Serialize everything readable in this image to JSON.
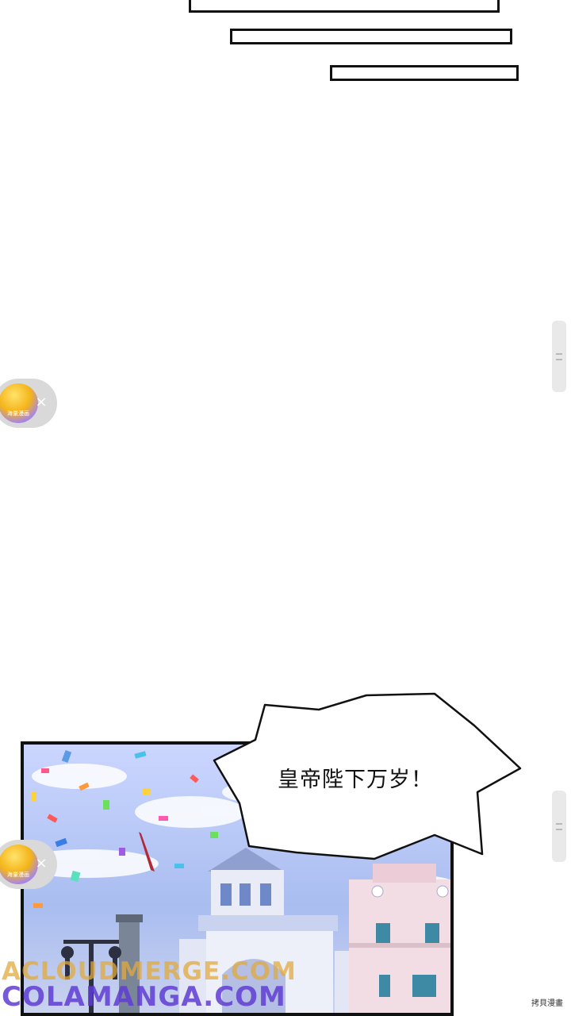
{
  "speech_bubble": {
    "text": "皇帝陛下万岁！"
  },
  "float_ads": [
    {
      "badge_text": "海量漫画",
      "close_symbol": "×"
    },
    {
      "badge_text": "海量漫画",
      "close_symbol": "×"
    }
  ],
  "watermark": {
    "line1": "ACLOUDMERGE.COM",
    "line2": "COLAMANGA.COM"
  },
  "credit": "拷貝漫畫",
  "icons": [
    "close-icon",
    "scroll-handle-icon"
  ]
}
